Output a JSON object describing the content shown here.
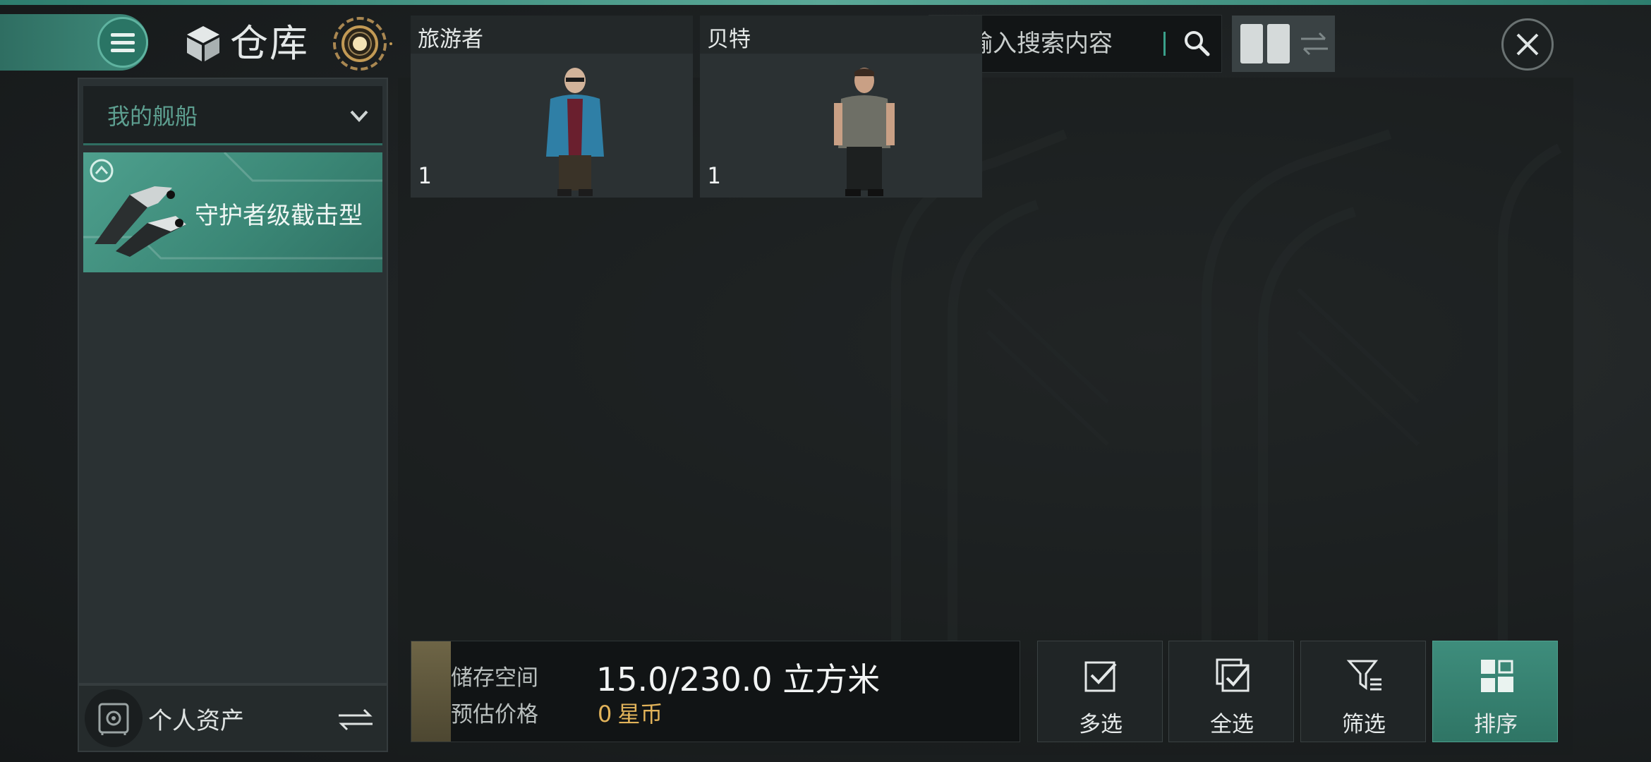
{
  "header": {
    "title": "仓库",
    "menu_icon": "hamburger-menu-icon",
    "title_icon": "warehouse-cube-icon",
    "orb_icon": "radar-orb-icon",
    "close_icon": "close-icon"
  },
  "search": {
    "placeholder": "请输入搜索内容",
    "icon": "search-icon"
  },
  "view_toggle": {
    "active_icon": "grid-view-icon",
    "inactive_icon": "swap-arrows-icon"
  },
  "sidebar": {
    "dropdown_label": "我的舰船",
    "ship": {
      "name": "守护者级截击型",
      "icon": "ship-icon"
    },
    "assets_label": "个人资产",
    "assets_icon": "vault-icon",
    "assets_swap_icon": "swap-arrows-icon"
  },
  "items": [
    {
      "name": "旅游者",
      "quantity": "1",
      "figure": "traveler-character"
    },
    {
      "name": "贝特",
      "quantity": "1",
      "figure": "bet-character"
    }
  ],
  "storage": {
    "label": "储存空间",
    "value": "15.0/230.0 立方米",
    "price_label": "预估价格",
    "price_value": "0",
    "price_unit": "星币"
  },
  "actions": [
    {
      "label": "多选",
      "icon": "checkbox-icon",
      "active": false
    },
    {
      "label": "全选",
      "icon": "select-all-icon",
      "active": false
    },
    {
      "label": "筛选",
      "icon": "filter-icon",
      "active": false
    },
    {
      "label": "排序",
      "icon": "sort-grid-icon",
      "active": true
    }
  ],
  "colors": {
    "accent_teal": "#3e8d7c",
    "price_gold": "#e2b35a",
    "panel_bg": "#2a3133"
  }
}
